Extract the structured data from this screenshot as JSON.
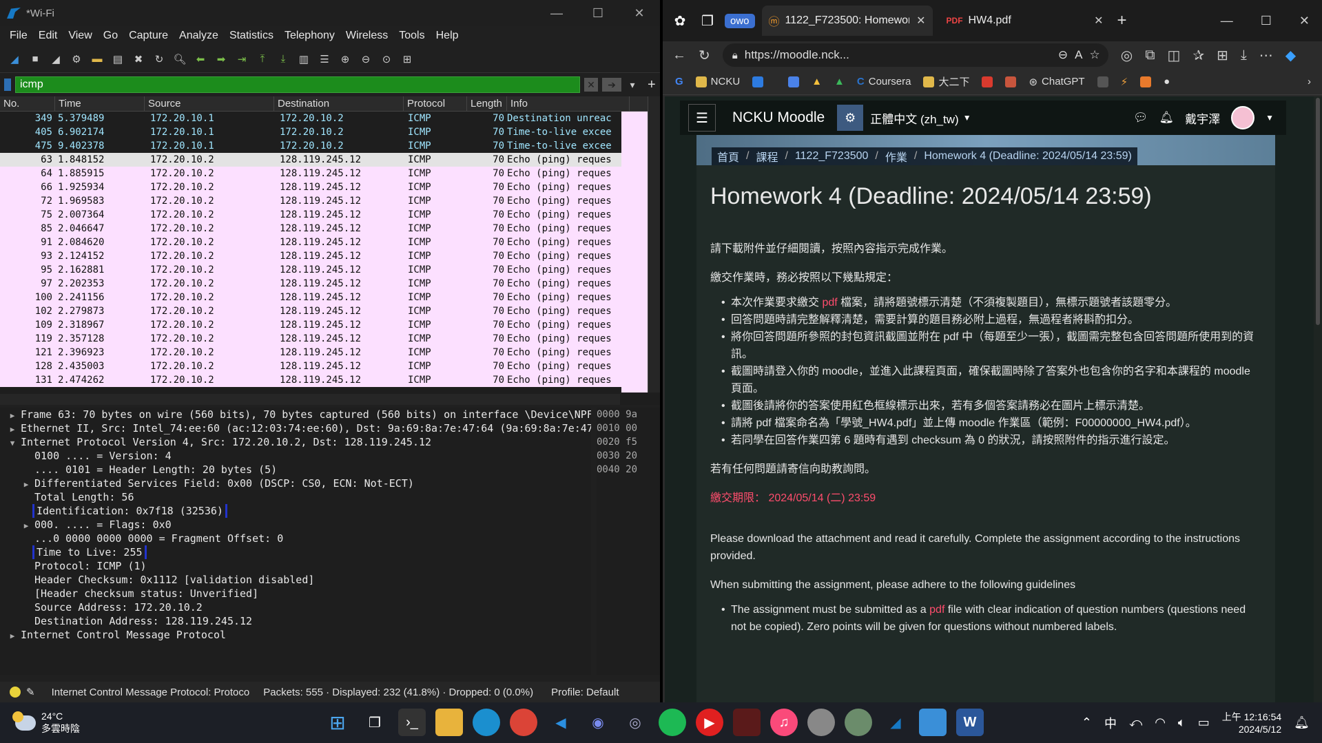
{
  "wireshark": {
    "window_title": "*Wi-Fi",
    "menu": [
      "File",
      "Edit",
      "View",
      "Go",
      "Capture",
      "Analyze",
      "Statistics",
      "Telephony",
      "Wireless",
      "Tools",
      "Help"
    ],
    "filter_value": "icmp",
    "columns": [
      "No.",
      "Time",
      "Source",
      "Destination",
      "Protocol",
      "Length",
      "Info"
    ],
    "packets": [
      {
        "no": "349",
        "time": "5.379489",
        "src": "172.20.10.1",
        "dst": "172.20.10.2",
        "proto": "ICMP",
        "len": "70",
        "info": "Destination unreac",
        "style": "dark"
      },
      {
        "no": "405",
        "time": "6.902174",
        "src": "172.20.10.1",
        "dst": "172.20.10.2",
        "proto": "ICMP",
        "len": "70",
        "info": "Time-to-live excee",
        "style": "dark"
      },
      {
        "no": "475",
        "time": "9.402378",
        "src": "172.20.10.1",
        "dst": "172.20.10.2",
        "proto": "ICMP",
        "len": "70",
        "info": "Time-to-live excee",
        "style": "dark"
      },
      {
        "no": "63",
        "time": "1.848152",
        "src": "172.20.10.2",
        "dst": "128.119.245.12",
        "proto": "ICMP",
        "len": "70",
        "info": "Echo (ping) reques",
        "style": "sel"
      },
      {
        "no": "64",
        "time": "1.885915",
        "src": "172.20.10.2",
        "dst": "128.119.245.12",
        "proto": "ICMP",
        "len": "70",
        "info": "Echo (ping) reques",
        "style": "pink"
      },
      {
        "no": "66",
        "time": "1.925934",
        "src": "172.20.10.2",
        "dst": "128.119.245.12",
        "proto": "ICMP",
        "len": "70",
        "info": "Echo (ping) reques",
        "style": "pink"
      },
      {
        "no": "72",
        "time": "1.969583",
        "src": "172.20.10.2",
        "dst": "128.119.245.12",
        "proto": "ICMP",
        "len": "70",
        "info": "Echo (ping) reques",
        "style": "pink"
      },
      {
        "no": "75",
        "time": "2.007364",
        "src": "172.20.10.2",
        "dst": "128.119.245.12",
        "proto": "ICMP",
        "len": "70",
        "info": "Echo (ping) reques",
        "style": "pink"
      },
      {
        "no": "85",
        "time": "2.046647",
        "src": "172.20.10.2",
        "dst": "128.119.245.12",
        "proto": "ICMP",
        "len": "70",
        "info": "Echo (ping) reques",
        "style": "pink"
      },
      {
        "no": "91",
        "time": "2.084620",
        "src": "172.20.10.2",
        "dst": "128.119.245.12",
        "proto": "ICMP",
        "len": "70",
        "info": "Echo (ping) reques",
        "style": "pink"
      },
      {
        "no": "93",
        "time": "2.124152",
        "src": "172.20.10.2",
        "dst": "128.119.245.12",
        "proto": "ICMP",
        "len": "70",
        "info": "Echo (ping) reques",
        "style": "pink"
      },
      {
        "no": "95",
        "time": "2.162881",
        "src": "172.20.10.2",
        "dst": "128.119.245.12",
        "proto": "ICMP",
        "len": "70",
        "info": "Echo (ping) reques",
        "style": "pink"
      },
      {
        "no": "97",
        "time": "2.202353",
        "src": "172.20.10.2",
        "dst": "128.119.245.12",
        "proto": "ICMP",
        "len": "70",
        "info": "Echo (ping) reques",
        "style": "pink"
      },
      {
        "no": "100",
        "time": "2.241156",
        "src": "172.20.10.2",
        "dst": "128.119.245.12",
        "proto": "ICMP",
        "len": "70",
        "info": "Echo (ping) reques",
        "style": "pink"
      },
      {
        "no": "102",
        "time": "2.279873",
        "src": "172.20.10.2",
        "dst": "128.119.245.12",
        "proto": "ICMP",
        "len": "70",
        "info": "Echo (ping) reques",
        "style": "pink"
      },
      {
        "no": "109",
        "time": "2.318967",
        "src": "172.20.10.2",
        "dst": "128.119.245.12",
        "proto": "ICMP",
        "len": "70",
        "info": "Echo (ping) reques",
        "style": "pink"
      },
      {
        "no": "119",
        "time": "2.357128",
        "src": "172.20.10.2",
        "dst": "128.119.245.12",
        "proto": "ICMP",
        "len": "70",
        "info": "Echo (ping) reques",
        "style": "pink"
      },
      {
        "no": "121",
        "time": "2.396923",
        "src": "172.20.10.2",
        "dst": "128.119.245.12",
        "proto": "ICMP",
        "len": "70",
        "info": "Echo (ping) reques",
        "style": "pink"
      },
      {
        "no": "128",
        "time": "2.435003",
        "src": "172.20.10.2",
        "dst": "128.119.245.12",
        "proto": "ICMP",
        "len": "70",
        "info": "Echo (ping) reques",
        "style": "pink"
      },
      {
        "no": "131",
        "time": "2.474262",
        "src": "172.20.10.2",
        "dst": "128.119.245.12",
        "proto": "ICMP",
        "len": "70",
        "info": "Echo (ping) reques",
        "style": "pink"
      }
    ],
    "details": [
      {
        "tri": "▶",
        "indent": 0,
        "text": "Frame 63: 70 bytes on wire (560 bits), 70 bytes captured (560 bits) on interface \\Device\\NPF_",
        "boxed": false
      },
      {
        "tri": "▶",
        "indent": 0,
        "text": "Ethernet II, Src: Intel_74:ee:60 (ac:12:03:74:ee:60), Dst: 9a:69:8a:7e:47:64 (9a:69:8a:7e:47:",
        "boxed": false
      },
      {
        "tri": "▼",
        "indent": 0,
        "text": "Internet Protocol Version 4, Src: 172.20.10.2, Dst: 128.119.245.12",
        "boxed": false
      },
      {
        "tri": "",
        "indent": 1,
        "text": "0100 .... = Version: 4",
        "boxed": false
      },
      {
        "tri": "",
        "indent": 1,
        "text": ".... 0101 = Header Length: 20 bytes (5)",
        "boxed": false
      },
      {
        "tri": "▶",
        "indent": 1,
        "text": "Differentiated Services Field: 0x00 (DSCP: CS0, ECN: Not-ECT)",
        "boxed": false
      },
      {
        "tri": "",
        "indent": 1,
        "text": "Total Length: 56",
        "boxed": false
      },
      {
        "tri": "",
        "indent": 1,
        "text": "Identification: 0x7f18 (32536)",
        "boxed": true
      },
      {
        "tri": "▶",
        "indent": 1,
        "text": "000. .... = Flags: 0x0",
        "boxed": false
      },
      {
        "tri": "",
        "indent": 1,
        "text": "...0 0000 0000 0000 = Fragment Offset: 0",
        "boxed": false
      },
      {
        "tri": "",
        "indent": 1,
        "text": "Time to Live: 255",
        "boxed": true
      },
      {
        "tri": "",
        "indent": 1,
        "text": "Protocol: ICMP (1)",
        "boxed": false
      },
      {
        "tri": "",
        "indent": 1,
        "text": "Header Checksum: 0x1112 [validation disabled]",
        "boxed": false
      },
      {
        "tri": "",
        "indent": 1,
        "text": "[Header checksum status: Unverified]",
        "boxed": false
      },
      {
        "tri": "",
        "indent": 1,
        "text": "Source Address: 172.20.10.2",
        "boxed": false
      },
      {
        "tri": "",
        "indent": 1,
        "text": "Destination Address: 128.119.245.12",
        "boxed": false
      },
      {
        "tri": "▶",
        "indent": 0,
        "text": "Internet Control Message Protocol",
        "boxed": false
      }
    ],
    "hex": [
      "0000  9a",
      "0010  00",
      "0020  f5",
      "0030  20",
      "0040  20"
    ],
    "status": {
      "field": "Internet Control Message Protocol: Protoco",
      "counts": "Packets: 555 · Displayed: 232 (41.8%) · Dropped: 0 (0.0%)",
      "profile": "Profile: Default"
    }
  },
  "browser": {
    "tab_owo": "owo",
    "tab1_title": "1122_F723500: Homework",
    "tab2_title": "HW4.pdf",
    "url": "https://moodle.nck...",
    "favorites": [
      "NCKU",
      "Coursera",
      "大二下",
      "ChatGPT"
    ],
    "moodle": {
      "brand": "NCKU Moodle",
      "language": "正體中文 (zh_tw)",
      "user": "戴宇澤",
      "breadcrumbs": [
        "首頁",
        "課程",
        "1122_F723500",
        "作業",
        "Homework 4 (Deadline: 2024/05/14 23:59)"
      ],
      "title": "Homework 4 (Deadline: 2024/05/14 23:59)",
      "intro_zh": "請下載附件並仔細閱讀，按照內容指示完成作業。",
      "rules_lead_zh": "繳交作業時，務必按照以下幾點規定：",
      "rule1_a": "本次作業要求繳交 ",
      "rule1_pdf": "pdf",
      "rule1_b": " 檔案，請將題號標示清楚（不須複製題目），無標示題號者該題零分。",
      "rule2": "回答問題時請完整解釋清楚，需要計算的題目務必附上過程，無過程者將斟酌扣分。",
      "rule3": "將你回答問題所參照的封包資訊截圖並附在 pdf 中（每題至少一張），截圖需完整包含回答問題所使用到的資訊。",
      "rule4": "截圖時請登入你的 moodle，並進入此課程頁面，確保截圖時除了答案外也包含你的名字和本課程的 moodle 頁面。",
      "rule5": "截圖後請將你的答案使用紅色框線標示出來，若有多個答案請務必在圖片上標示清楚。",
      "rule6": "請將 pdf 檔案命名為「學號_HW4.pdf」並上傳 moodle 作業區（範例：F00000000_HW4.pdf）。",
      "rule7": "若同學在回答作業四第 6 題時有遇到 checksum 為 0 的狀況，請按照附件的指示進行設定。",
      "contact_zh": "若有任何問題請寄信向助教詢問。",
      "deadline": "繳交期限： 2024/05/14 (二) 23:59",
      "intro_en": "Please download the attachment and read it carefully. Complete the assignment according to the instructions provided.",
      "rules_lead_en": "When submitting the assignment, please adhere to the following guidelines",
      "rule_en1_a": "The assignment must be submitted as a ",
      "rule_en1_pdf": "pdf",
      "rule_en1_b": " file with clear indication of question numbers (questions need not be copied). Zero points will be given for questions without numbered labels."
    }
  },
  "taskbar": {
    "temp": "24°C",
    "weather": "多雲時陰",
    "ime": "中",
    "time": "上午 12:16:54",
    "date": "2024/5/12"
  }
}
